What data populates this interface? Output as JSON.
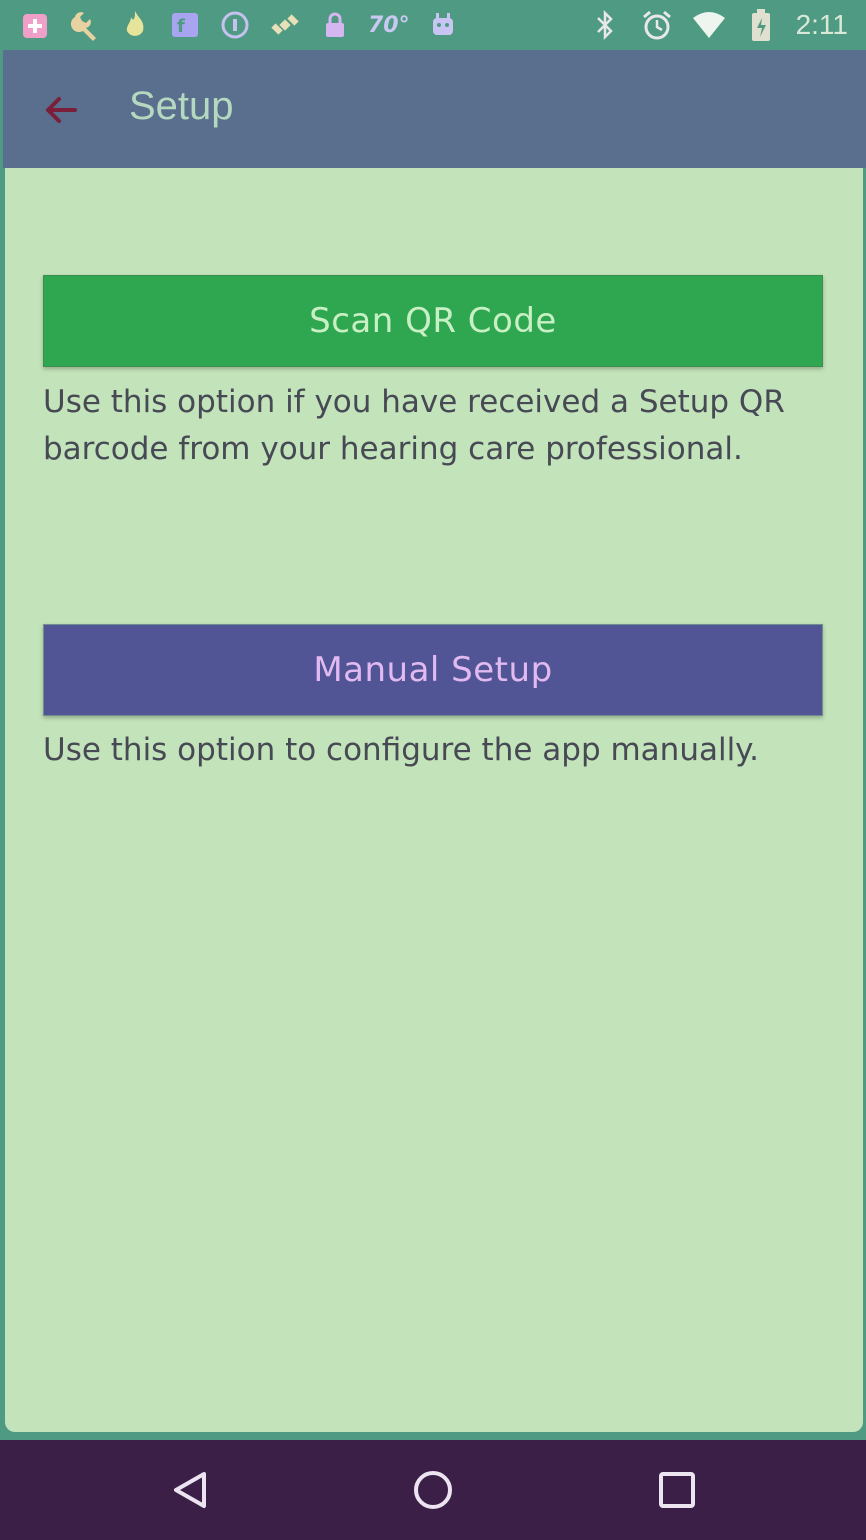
{
  "status_bar": {
    "left_icons": [
      "health-icon",
      "wrench-icon",
      "flame-icon",
      "fake-news-icon",
      "info-circle-icon",
      "satellite-icon",
      "lock-icon"
    ],
    "temperature": "70°",
    "android-icon": "android-icon",
    "right_icons": [
      "bluetooth-icon",
      "alarm-icon",
      "wifi-icon",
      "battery-icon"
    ],
    "time": "2:11"
  },
  "app_bar": {
    "back_icon": "arrow-back-icon",
    "title": "Setup"
  },
  "setup": {
    "scan_button_label": "Scan QR Code",
    "scan_description": "Use this option if you have received a Setup QR barcode from your hearing care professional.",
    "manual_button_label": "Manual Setup",
    "manual_description": "Use this option to configure the app manually."
  },
  "nav_bar": {
    "back": "nav-back-icon",
    "home": "nav-home-icon",
    "recents": "nav-recents-icon"
  },
  "colors": {
    "status_bar": "#4f9a82",
    "app_bar": "#5a6e8d",
    "content_bg": "#c3e3ba",
    "scan_button": "#2ea750",
    "manual_button": "#525595",
    "nav_bar": "#3b1f47"
  }
}
